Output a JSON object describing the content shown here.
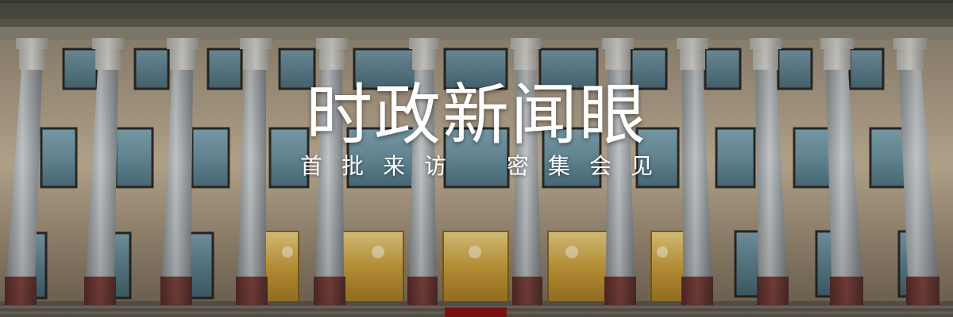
{
  "banner": {
    "title": "时政新闻眼",
    "subtitle": [
      "首",
      "批",
      "来",
      "访",
      "",
      "密",
      "集",
      "会",
      "见"
    ]
  },
  "colors": {
    "sky": "#3a3a34",
    "facade": "#b7a68d",
    "column": "#a8aeb2",
    "column_base": "#7a3d39",
    "window_glass": "#6f98a8",
    "door_gold": "#e8c35a",
    "carpet": "#a01818"
  }
}
